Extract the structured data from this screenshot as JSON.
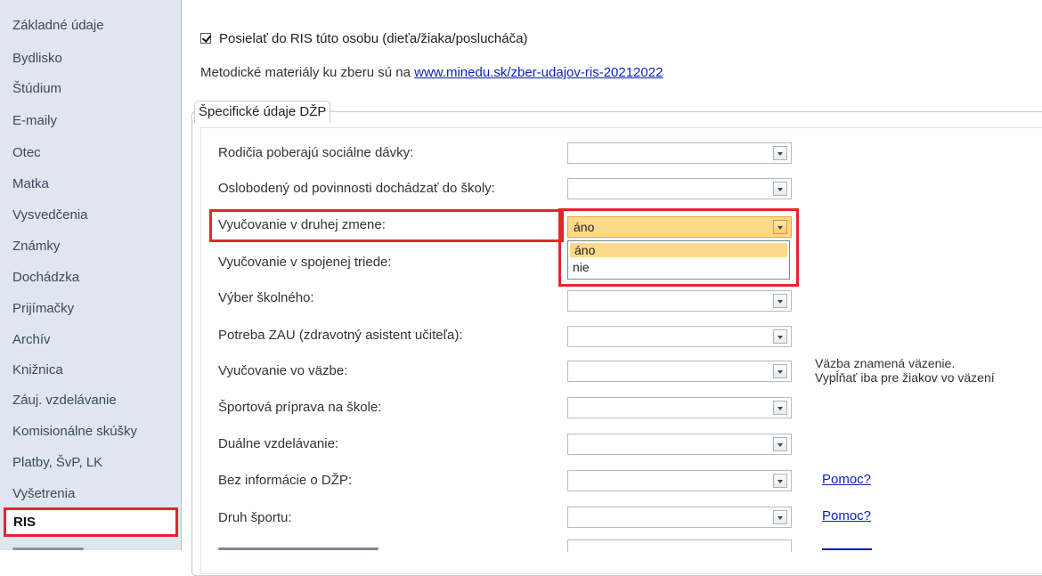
{
  "sidebar": {
    "items": [
      {
        "label": "Základné údaje"
      },
      {
        "label": "Bydlisko"
      },
      {
        "label": "Štúdium"
      },
      {
        "label": "E-maily"
      },
      {
        "label": "Otec"
      },
      {
        "label": "Matka"
      },
      {
        "label": "Vysvedčenia"
      },
      {
        "label": "Známky"
      },
      {
        "label": "Dochádzka"
      },
      {
        "label": "Prijímačky"
      },
      {
        "label": "Archív"
      },
      {
        "label": "Knižnica"
      },
      {
        "label": "Záuj. vzdelávanie"
      },
      {
        "label": "Komisionálne skúšky"
      },
      {
        "label": "Platby, ŠvP, LK"
      },
      {
        "label": "Vyšetrenia"
      },
      {
        "label": "RIS"
      }
    ],
    "active": "RIS"
  },
  "main": {
    "send_checkbox": {
      "label": "Posielať do RIS túto osobu (dieťa/žiaka/poslucháča)",
      "checked": true
    },
    "methodology": {
      "text": "Metodické materiály ku zberu sú na ",
      "link": "www.minedu.sk/zber-udajov-ris-20212022"
    },
    "group_title": "Špecifické údaje DŽP",
    "fields": [
      {
        "label": "Rodičia poberajú sociálne dávky:",
        "value": ""
      },
      {
        "label": "Oslobodený od povinnosti dochádzať do školy:",
        "value": ""
      },
      {
        "label": "Vyučovanie v druhej zmene:",
        "value": "áno"
      },
      {
        "label": "Vyučovanie v spojenej triede:",
        "value": ""
      },
      {
        "label": "Výber školného:",
        "value": ""
      },
      {
        "label": "Potreba ZAU (zdravotný asistent učiteľa):",
        "value": ""
      },
      {
        "label": "Vyučovanie vo väzbe:",
        "value": ""
      },
      {
        "label": "Športová príprava na škole:",
        "value": ""
      },
      {
        "label": "Duálne vzdelávanie:",
        "value": ""
      },
      {
        "label": "Bez informácie o DŽP:",
        "value": ""
      },
      {
        "label": "Druh športu:",
        "value": ""
      }
    ],
    "dropdown_options": [
      "áno",
      "nie"
    ],
    "vazba_note": {
      "line1": "Väzba znamená väzenie.",
      "line2": "Vypĺňať iba pre žiakov vo väzení"
    },
    "help_link": "Pomoc?"
  },
  "colors": {
    "highlight": "#e4262b",
    "sidebar_bg": "#dfe6ef",
    "link": "#0a1fc0",
    "selection": "#ffd98a"
  }
}
